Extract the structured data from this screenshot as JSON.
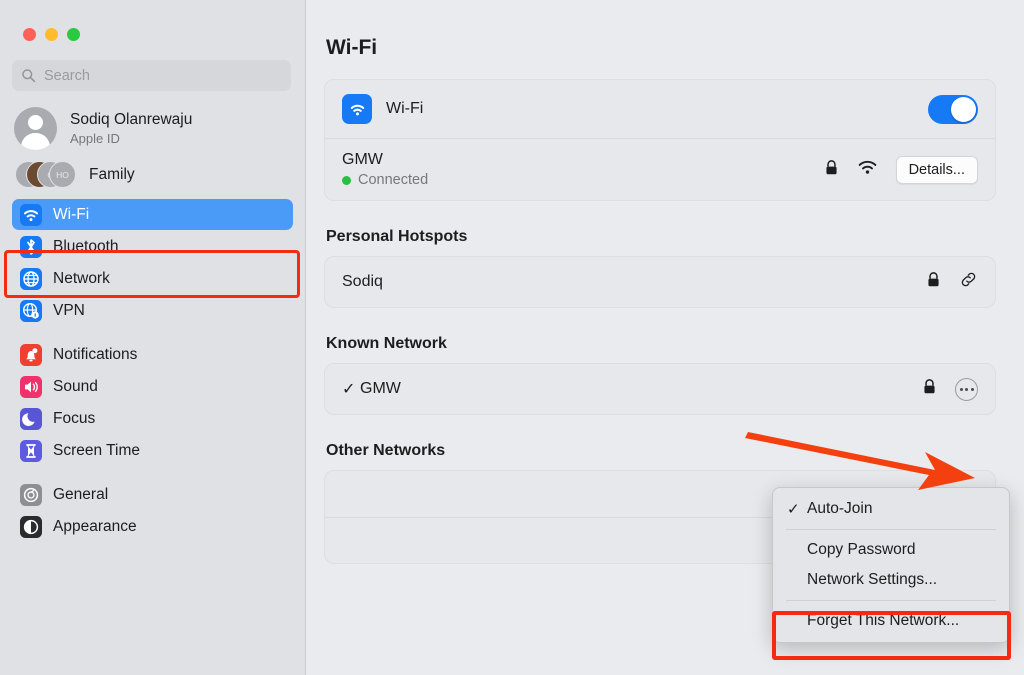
{
  "window": {
    "traffic_lights": [
      {
        "name": "close",
        "color": "#ff6159"
      },
      {
        "name": "minimize",
        "color": "#ffbd2e"
      },
      {
        "name": "zoom",
        "color": "#2ac940"
      }
    ]
  },
  "sidebar": {
    "search": {
      "value": "",
      "placeholder": "Search"
    },
    "account": {
      "name": "Sodiq Olanrewaju",
      "subtitle": "Apple ID"
    },
    "family": {
      "label": "Family",
      "avatar_initials": [
        "C",
        "",
        "C",
        "HO"
      ]
    },
    "groups": [
      {
        "items": [
          {
            "label": "Wi-Fi",
            "icon": "wifi-icon",
            "color": "#1679f5",
            "selected": true
          },
          {
            "label": "Bluetooth",
            "icon": "bluetooth-icon",
            "color": "#1679f5",
            "selected": false
          },
          {
            "label": "Network",
            "icon": "globe-icon",
            "color": "#1679f5",
            "selected": false
          },
          {
            "label": "VPN",
            "icon": "vpn-globe-icon",
            "color": "#1679f5",
            "selected": false
          }
        ]
      },
      {
        "items": [
          {
            "label": "Notifications",
            "icon": "bell-icon",
            "color": "#f03e30",
            "selected": false
          },
          {
            "label": "Sound",
            "icon": "speaker-icon",
            "color": "#f1316b",
            "selected": false
          },
          {
            "label": "Focus",
            "icon": "moon-icon",
            "color": "#5856d6",
            "selected": false
          },
          {
            "label": "Screen Time",
            "icon": "hourglass-icon",
            "color": "#5d5ce0",
            "selected": false
          }
        ]
      },
      {
        "items": [
          {
            "label": "General",
            "icon": "gear-icon",
            "color": "#8e8e93",
            "selected": false
          },
          {
            "label": "Appearance",
            "icon": "appearance-icon",
            "color": "#2b2b2e",
            "selected": false
          }
        ]
      }
    ]
  },
  "main": {
    "title": "Wi-Fi",
    "wifi_row": {
      "label": "Wi-Fi",
      "toggle_on": true
    },
    "connected_network": {
      "name": "GMW",
      "status": "Connected",
      "status_color": "#27c13f",
      "lock": "lock-icon",
      "signal": "wifi-signal-icon",
      "details_button": "Details..."
    },
    "personal_hotspots": {
      "title": "Personal Hotspots",
      "items": [
        {
          "name": "Sodiq",
          "lock": "lock-icon",
          "link": "link-icon"
        }
      ]
    },
    "known_network": {
      "title": "Known Network",
      "items": [
        {
          "name": "GMW",
          "checked": true,
          "lock": "lock-icon",
          "more": "more-ellipsis-icon"
        }
      ]
    },
    "other_networks": {
      "title": "Other Networks",
      "items": [
        {
          "name": ""
        },
        {
          "name": ""
        }
      ]
    }
  },
  "context_menu": {
    "items": [
      {
        "label": "Auto-Join",
        "checked": true
      },
      {
        "separator": true
      },
      {
        "label": "Copy Password",
        "checked": false
      },
      {
        "label": "Network Settings...",
        "checked": false
      },
      {
        "separator": true
      },
      {
        "label": "Forget This Network...",
        "checked": false,
        "highlighted": true
      }
    ]
  },
  "annotations": {
    "highlight_color": "#f42a11",
    "arrow_color": "#f4400f"
  }
}
